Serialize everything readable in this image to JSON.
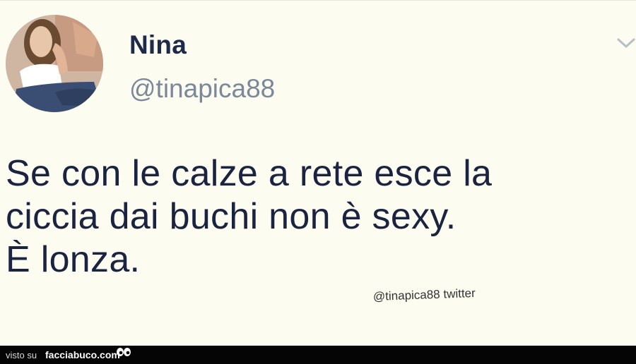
{
  "tweet": {
    "display_name": "Nina",
    "handle": "@tinapica88",
    "menu_icon": "chevron-down-icon",
    "text_lines": [
      "Se con le calze a rete esce la",
      "ciccia dai buchi non è sexy.",
      "È lonza."
    ],
    "watermark": "@tinapica88 twitter"
  },
  "footer": {
    "prefix": "visto su",
    "site": "facciabuco.com",
    "logo_icon": "eyes-icon"
  },
  "colors": {
    "background": "#fcfcf1",
    "name": "#1e2a4a",
    "handle": "#7a8899",
    "text": "#1a2340",
    "footer": "#050505"
  }
}
